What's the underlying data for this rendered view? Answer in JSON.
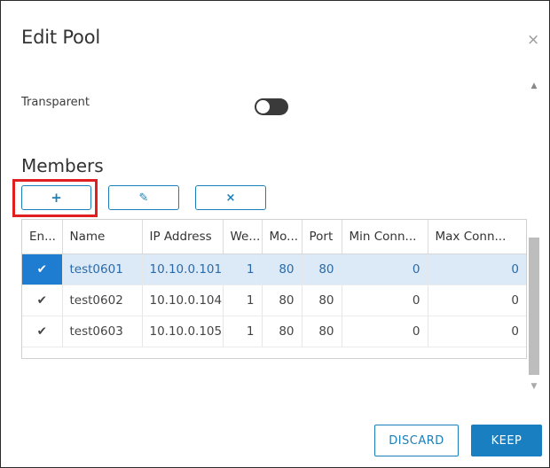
{
  "dialog": {
    "title": "Edit Pool",
    "close_icon": "×"
  },
  "transparent": {
    "label": "Transparent",
    "enabled": false
  },
  "members": {
    "title": "Members",
    "add_icon": "+",
    "edit_icon": "✎",
    "delete_icon": "×",
    "columns": [
      "En...",
      "Name",
      "IP Address",
      "We...",
      "Mo...",
      "Port",
      "Min Conn...",
      "Max Conn..."
    ],
    "rows": [
      {
        "enabled": "✔",
        "name": "test0601",
        "ip": "10.10.0.101",
        "weight": "1",
        "monitor": "80",
        "port": "80",
        "min": "0",
        "max": "0"
      },
      {
        "enabled": "✔",
        "name": "test0602",
        "ip": "10.10.0.104",
        "weight": "1",
        "monitor": "80",
        "port": "80",
        "min": "0",
        "max": "0"
      },
      {
        "enabled": "✔",
        "name": "test0603",
        "ip": "10.10.0.105",
        "weight": "1",
        "monitor": "80",
        "port": "80",
        "min": "0",
        "max": "0"
      }
    ]
  },
  "footer": {
    "discard_label": "DISCARD",
    "keep_label": "KEEP"
  },
  "colors": {
    "accent": "#1a7fc1",
    "selected_row": "#dceaf7",
    "highlight_box": "#e02020"
  }
}
